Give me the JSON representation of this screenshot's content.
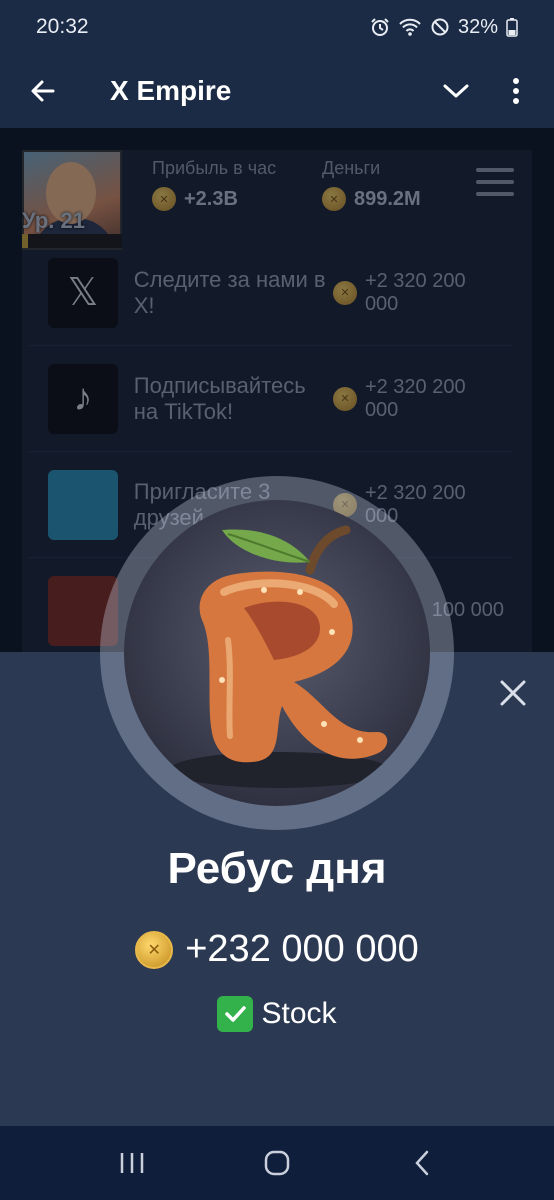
{
  "status_bar": {
    "time": "20:32",
    "battery": "32%",
    "icons": [
      "alarm-icon",
      "wifi-icon",
      "do-not-disturb-icon",
      "battery-icon"
    ]
  },
  "header": {
    "title": "X Empire",
    "icons": [
      "back-arrow-icon",
      "chevron-down-icon",
      "more-vert-icon"
    ]
  },
  "profile": {
    "level": "Ур. 21",
    "level_progress": 0.06,
    "profit_label": "Прибыль в час",
    "profit_value": "+2.3B",
    "money_label": "Деньги",
    "money_value": "899.2M"
  },
  "tasks": [
    {
      "text": "Следите за нами в X!",
      "reward": "+2 320 200 000",
      "icon": "x-logo-icon"
    },
    {
      "text": "Подписывайтесь на TikTok!",
      "reward": "+2 320 200 000",
      "icon": "tiktok-icon"
    },
    {
      "text": "Пригласите 3 друзей",
      "reward": "+2 320 200 000",
      "icon": "friends-image"
    },
    {
      "text": "",
      "reward": "100 000",
      "icon": "office-image"
    }
  ],
  "sheet": {
    "title": "Ребус дня",
    "reward": "+232 000 000",
    "status": "Stock",
    "image": "apple-letter-r-image"
  },
  "nav": {
    "icons": [
      "recent-apps-icon",
      "home-icon",
      "back-icon"
    ]
  },
  "colors": {
    "header_bg": "#1b2a45",
    "sheet_bg": "#2c3953",
    "coin": "#f3cf63",
    "check": "#33b24b"
  }
}
